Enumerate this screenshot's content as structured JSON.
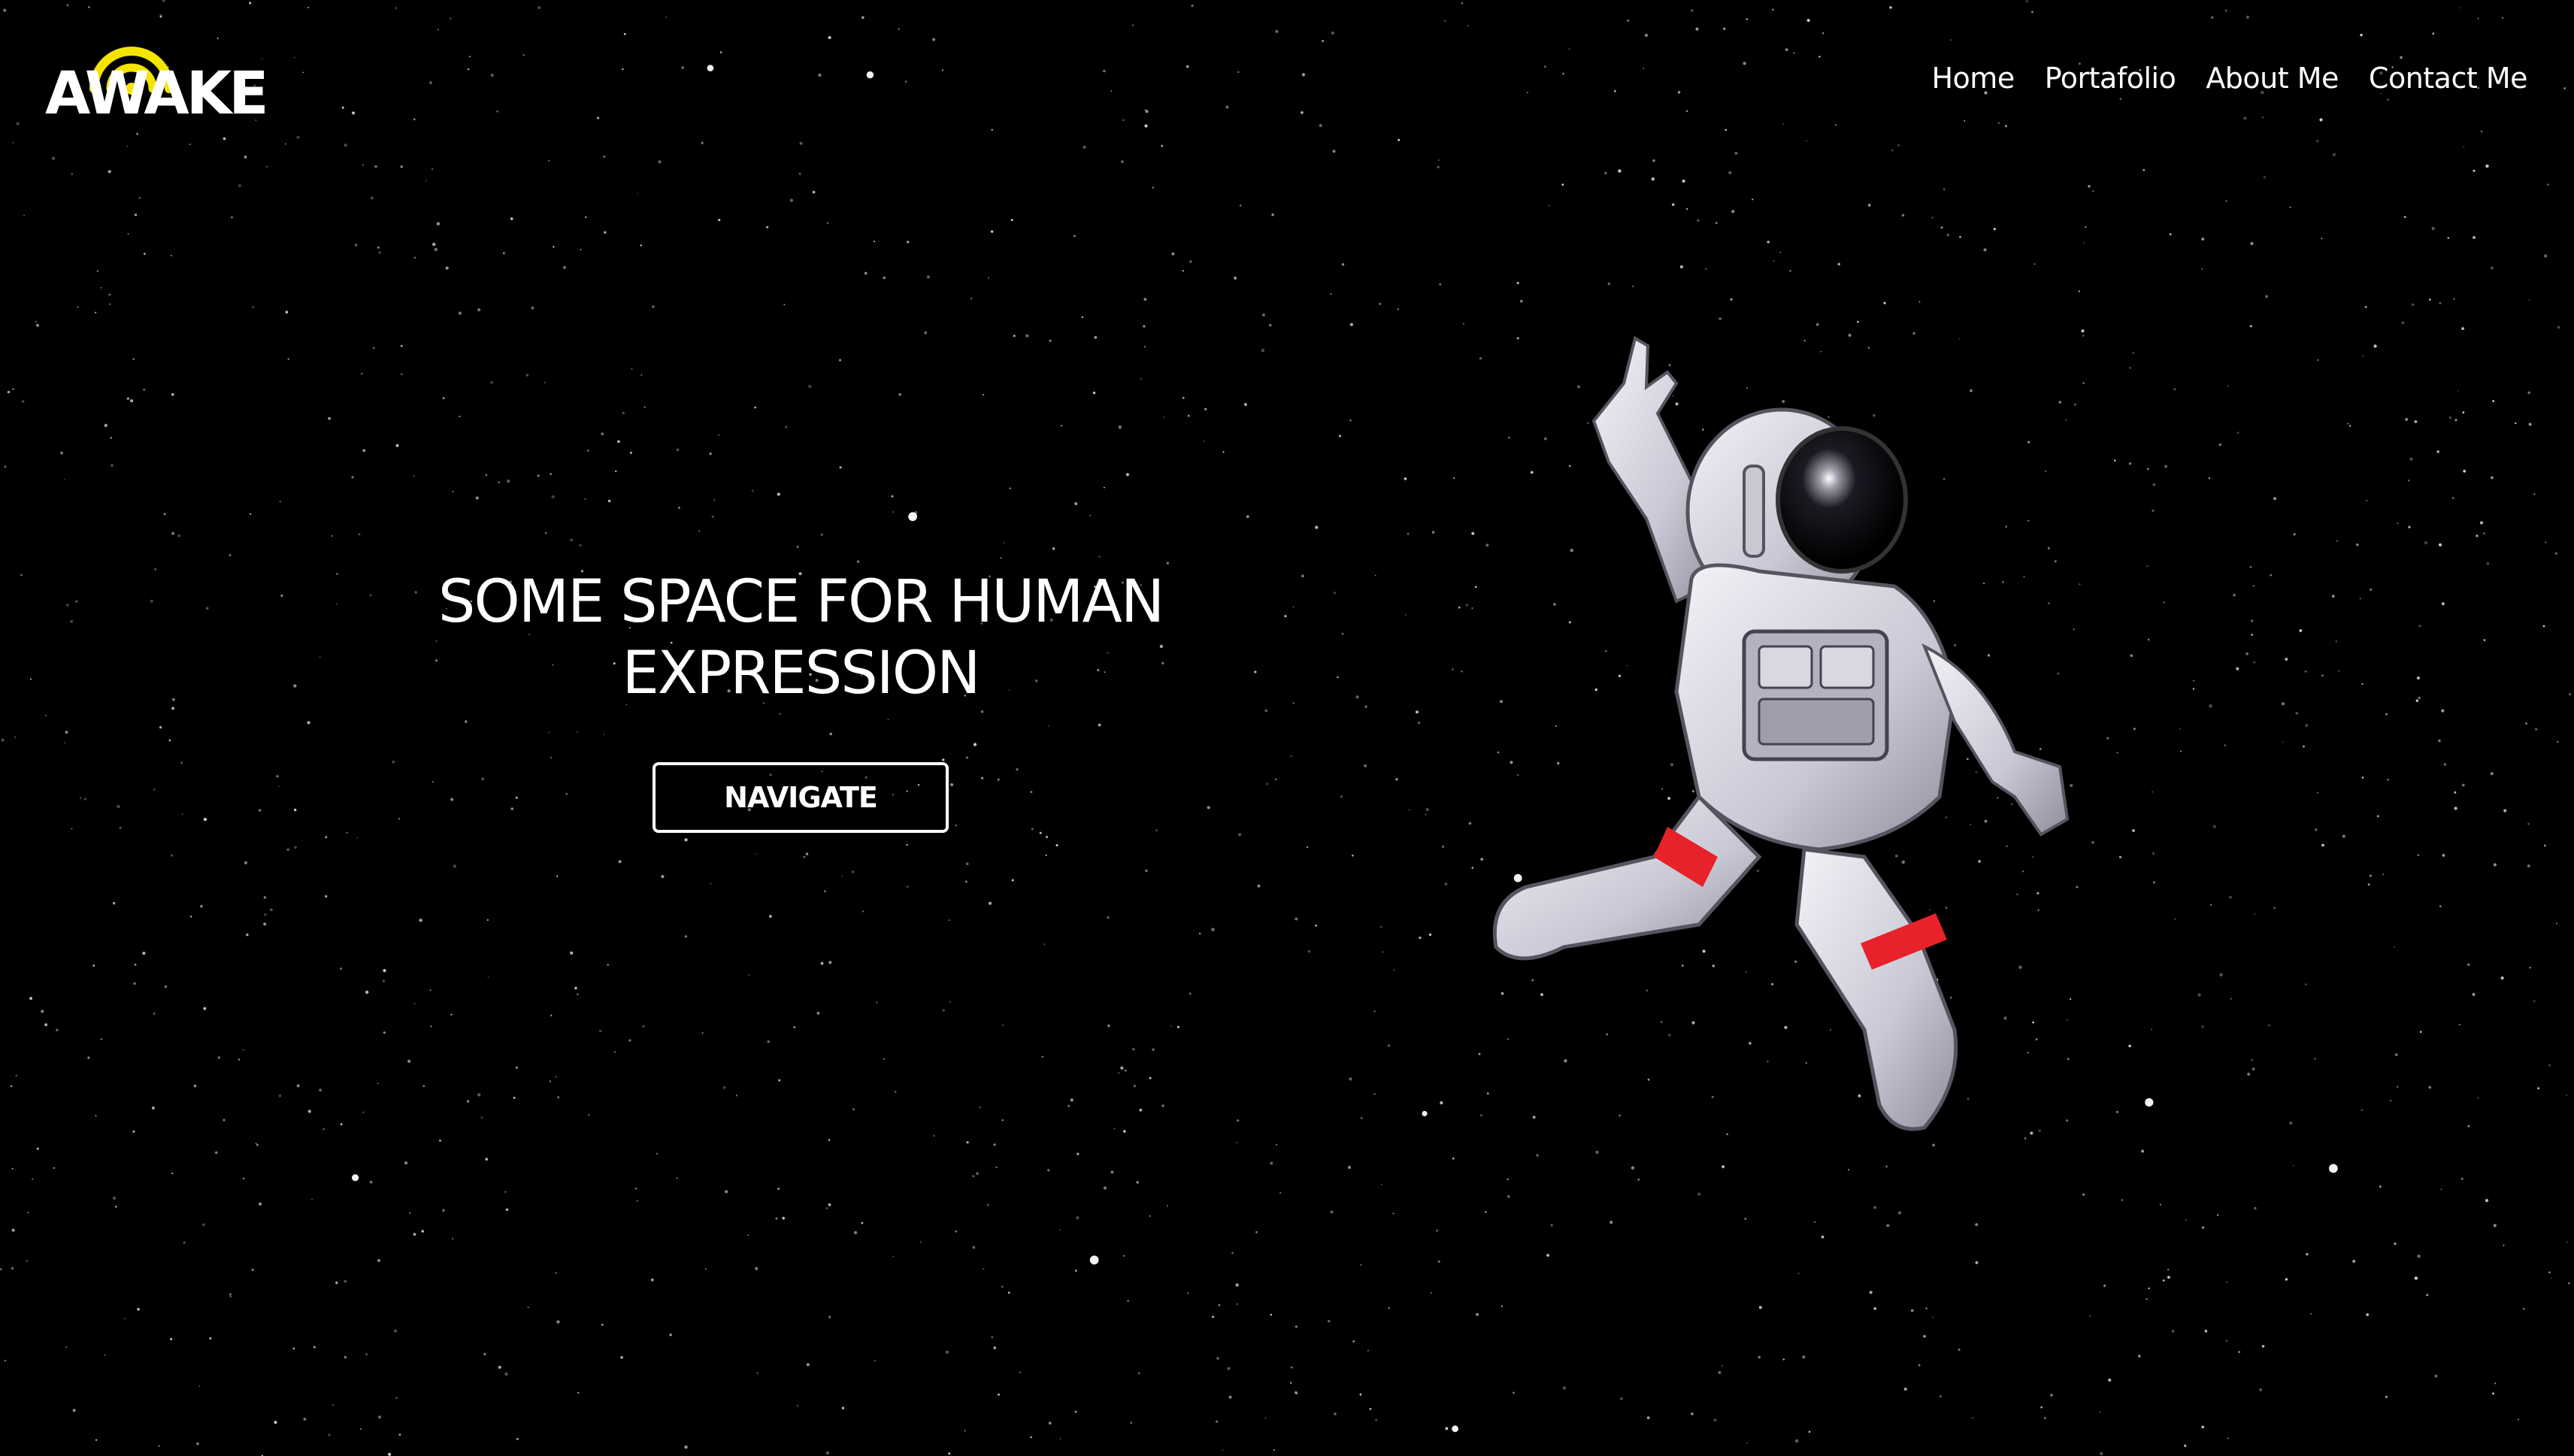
{
  "brand": {
    "name": "AWAKE",
    "logo_icon": "signal-arc-icon",
    "accent_color": "#f5e400"
  },
  "nav": {
    "items": [
      {
        "label": "Home"
      },
      {
        "label": "Portafolio"
      },
      {
        "label": "About Me"
      },
      {
        "label": "Contact Me"
      }
    ]
  },
  "hero": {
    "title_line1": "SOME SPACE FOR HUMAN",
    "title_line2": "EXPRESSION",
    "button_label": "NAVIGATE",
    "image": "astronaut-illustration"
  },
  "colors": {
    "background": "#000000",
    "text": "#ffffff",
    "suit_stripe": "#e8222a"
  }
}
